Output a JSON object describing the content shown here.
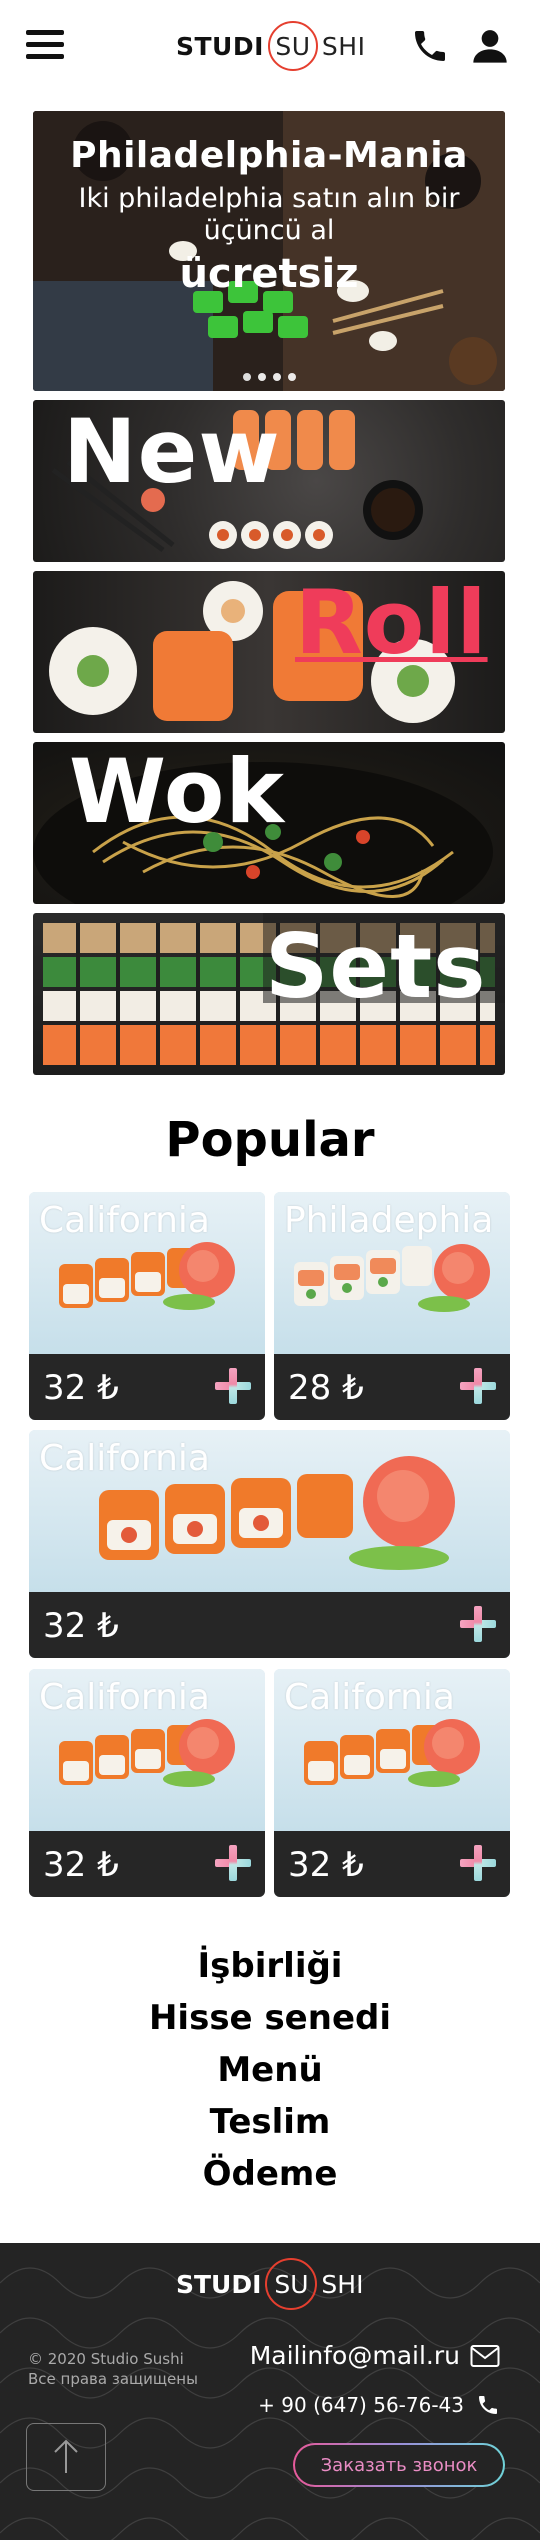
{
  "header": {
    "menu_icon": "hamburger-menu-icon",
    "logo": {
      "part1": "STUDI",
      "part2": "SU",
      "part3": "SHI"
    },
    "phone_icon": "phone-icon",
    "user_icon": "user-icon"
  },
  "banners": {
    "promo": {
      "title": "Philadelphia-Mania",
      "subtitle": "Iki philadelphia satın alın bir üçüncü al",
      "free": "ücretsiz"
    },
    "categories": [
      "New",
      "Roll",
      "Wok",
      "Sets"
    ],
    "colors": {
      "roll_accent": "#ef3c5a"
    }
  },
  "popular": {
    "title": "Popular",
    "cards": [
      {
        "name": "California",
        "price": "32 ₺"
      },
      {
        "name": "Philadephia",
        "price": "28 ₺"
      },
      {
        "name": "California",
        "price": "32 ₺"
      },
      {
        "name": "California",
        "price": "32 ₺"
      },
      {
        "name": "California",
        "price": "32 ₺"
      }
    ]
  },
  "footer_nav": [
    "İşbirliği",
    "Hisse senedi",
    "Menü",
    "Teslim",
    "Ödeme"
  ],
  "footer": {
    "logo": {
      "part1": "STUDI",
      "part2": "SU",
      "part3": "SHI"
    },
    "copyright_line1": "© 2020 Studio Sushi",
    "copyright_line2": "Все права защищены",
    "email": "Mailinfo@mail.ru",
    "phone": "+ 90 (647) 56-76-43",
    "callback_button": "Заказать звонок",
    "up_icon": "arrow-up-icon",
    "colors": {
      "background": "#242424",
      "logo_ring": "#e53f2f"
    }
  }
}
